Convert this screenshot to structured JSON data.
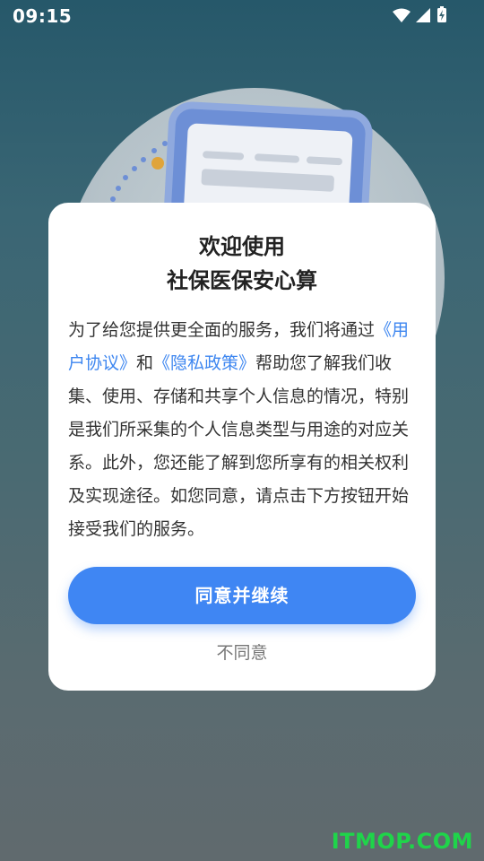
{
  "status_bar": {
    "time": "09:15",
    "icons": [
      "wifi-icon",
      "cellular-signal-icon",
      "battery-charging-icon"
    ]
  },
  "dialog": {
    "title_line1": "欢迎使用",
    "title_line2": "社保医保安心算",
    "body": {
      "intro": "为了给您提供更全面的服务，我们将通过",
      "user_agreement_link": "《用户协议》",
      "conjunction": "和",
      "privacy_policy_link": "《隐私政策》",
      "rest": "帮助您了解我们收集、使用、存储和共享个人信息的情况，特别是我们所采集的个人信息类型与用途的对应关系。此外，您还能了解到您所享有的相关权利及实现途径。如您同意，请点击下方按钮开始接受我们的服务。"
    },
    "agree_label": "同意并继续",
    "disagree_label": "不同意"
  },
  "watermark": "ITMOP.COM",
  "colors": {
    "accent": "#3f86f3",
    "link": "#3d86f0",
    "watermark": "#1fd44a"
  }
}
